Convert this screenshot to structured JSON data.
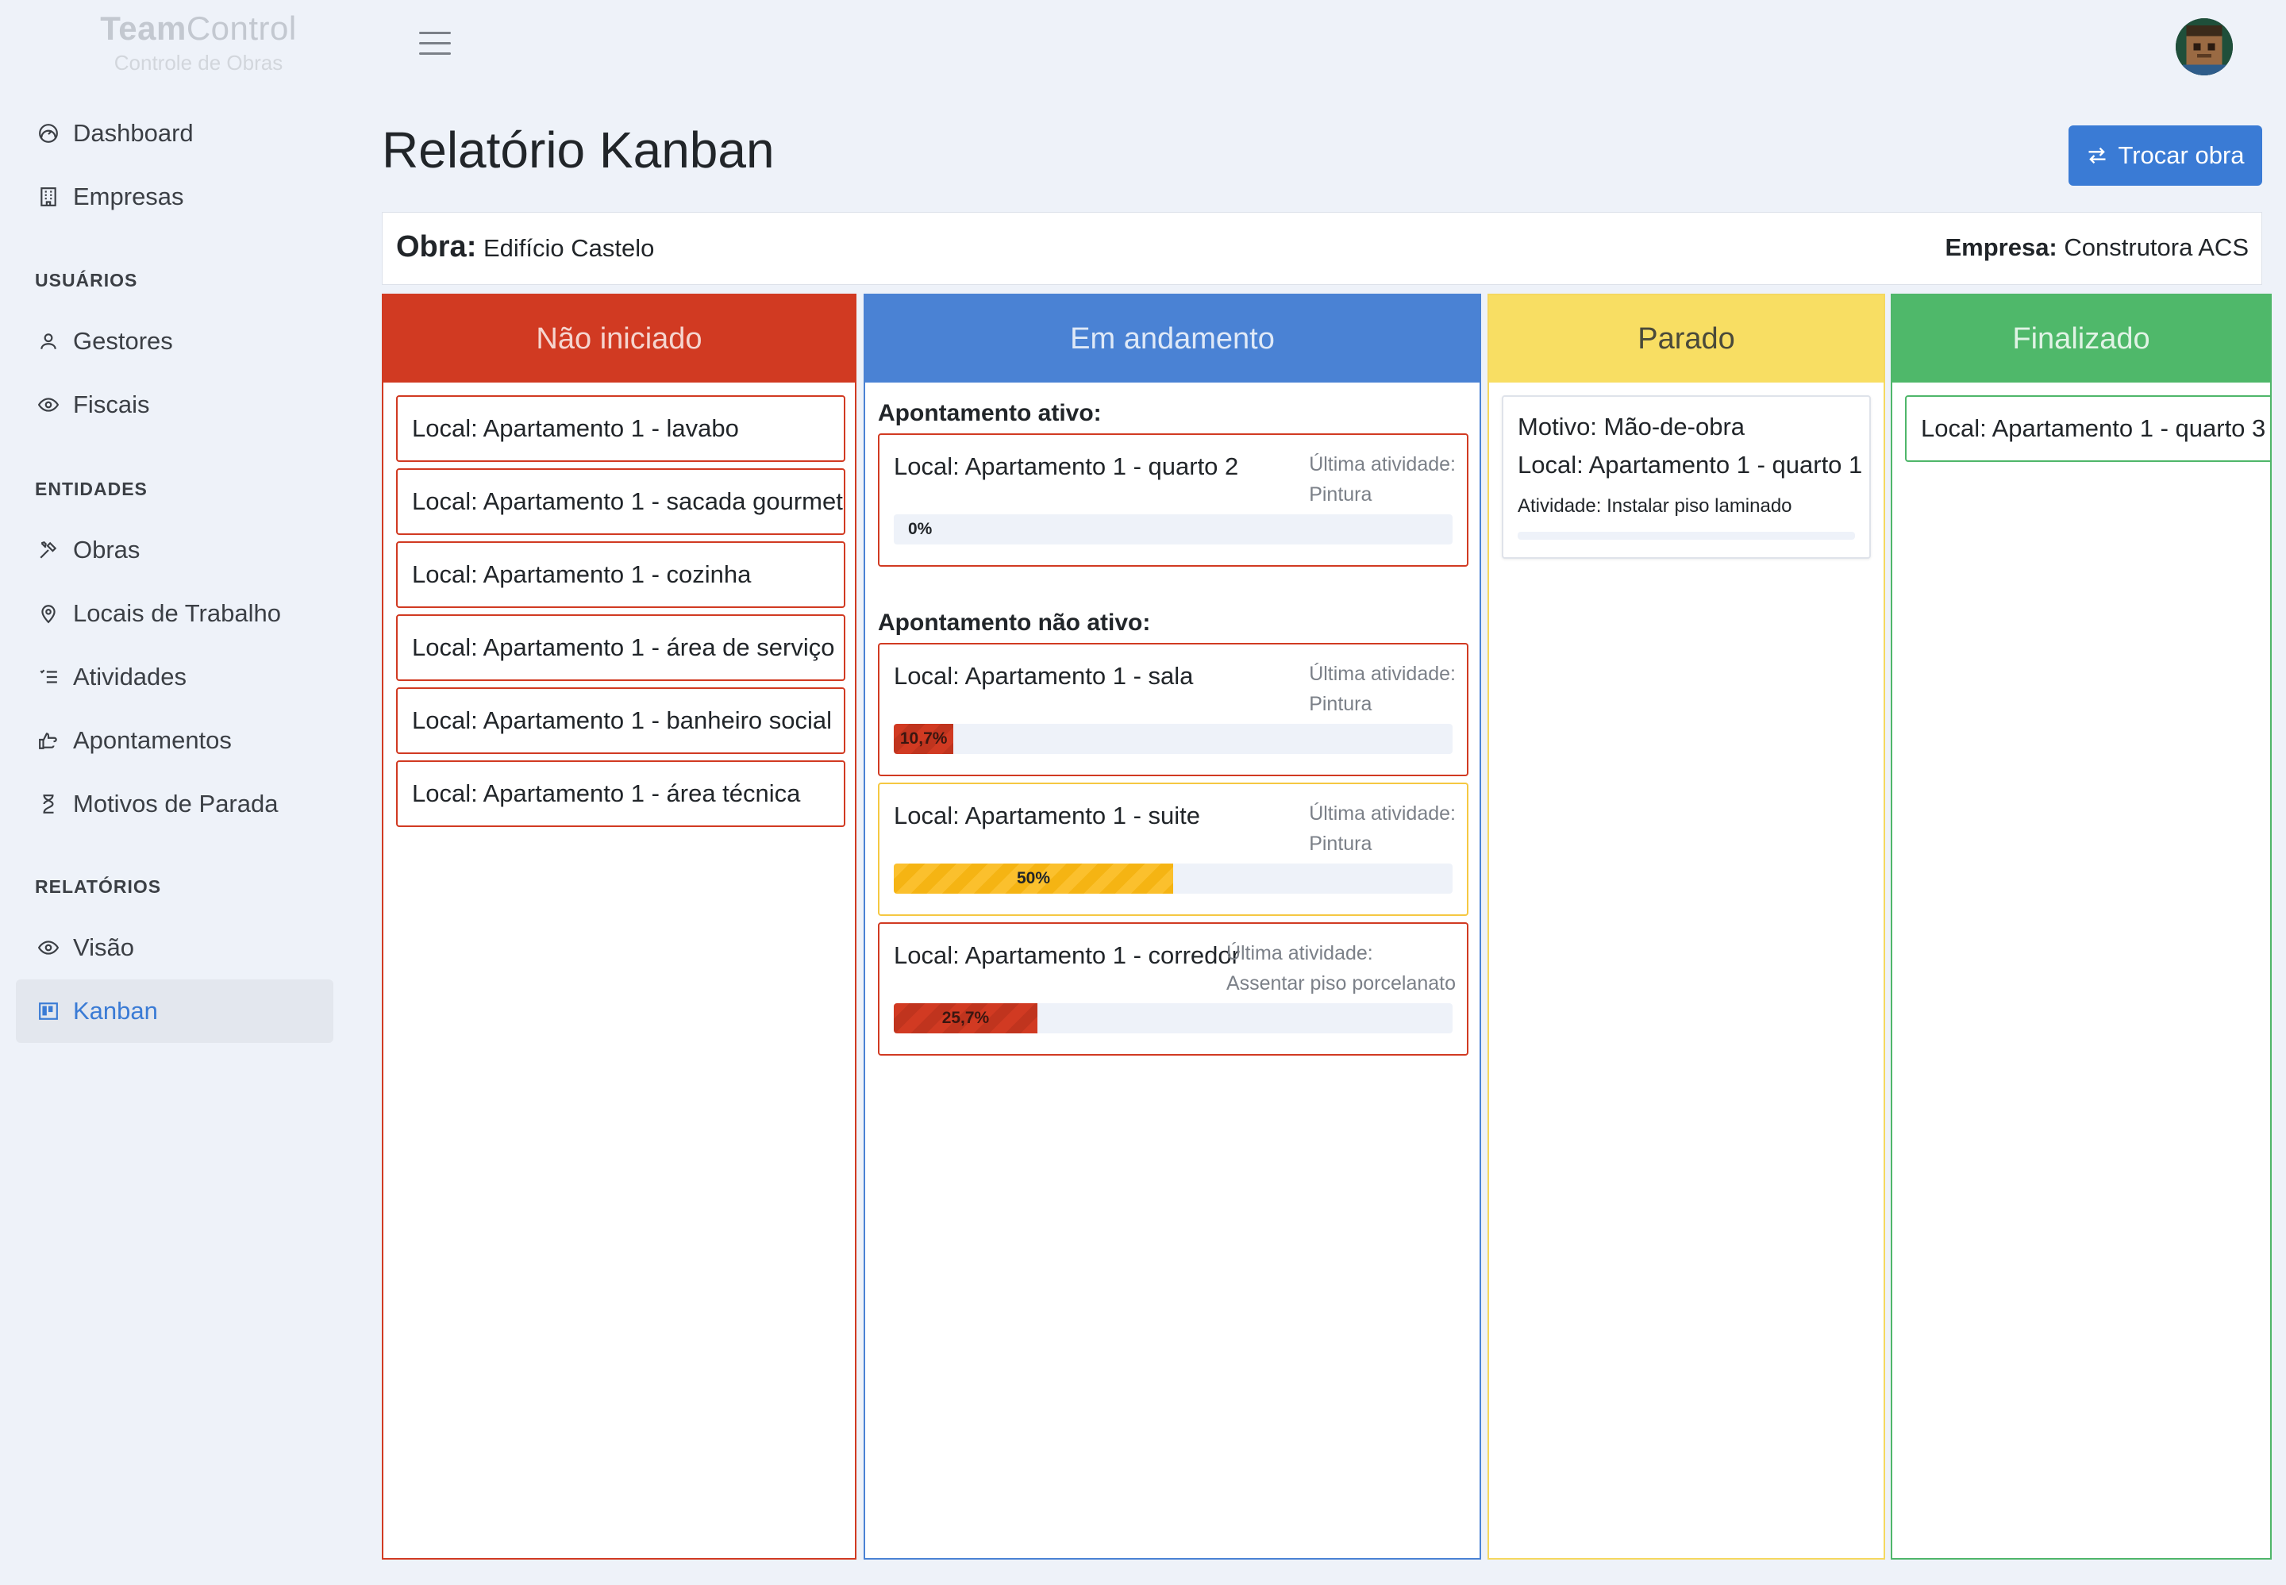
{
  "brand": {
    "title_bold": "Team",
    "title_rest": "Control",
    "subtitle": "Controle de Obras"
  },
  "sidebar": {
    "items": [
      {
        "label": "Dashboard",
        "icon": "speedometer-icon"
      },
      {
        "label": "Empresas",
        "icon": "building-icon"
      }
    ],
    "sections": [
      {
        "title": "USUÁRIOS",
        "items": [
          {
            "label": "Gestores",
            "icon": "person-icon"
          },
          {
            "label": "Fiscais",
            "icon": "eye-icon"
          }
        ]
      },
      {
        "title": "ENTIDADES",
        "items": [
          {
            "label": "Obras",
            "icon": "tools-icon"
          },
          {
            "label": "Locais de Trabalho",
            "icon": "map-pin-icon"
          },
          {
            "label": "Atividades",
            "icon": "list-check-icon"
          },
          {
            "label": "Apontamentos",
            "icon": "hand-pointing-icon"
          },
          {
            "label": "Motivos de Parada",
            "icon": "hourglass-icon"
          }
        ]
      },
      {
        "title": "RELATÓRIOS",
        "items": [
          {
            "label": "Visão",
            "icon": "eye-icon"
          },
          {
            "label": "Kanban",
            "icon": "kanban-icon",
            "active": true
          }
        ]
      }
    ]
  },
  "header": {
    "title": "Relatório Kanban",
    "switch_button": "Trocar obra"
  },
  "info": {
    "obra_label": "Obra:",
    "obra_value": "Edifício Castelo",
    "empresa_label": "Empresa:",
    "empresa_value": "Construtora ACS"
  },
  "columns": {
    "nao_iniciado": {
      "title": "Não iniciado",
      "cards": [
        "Local: Apartamento 1 - lavabo",
        "Local: Apartamento 1 - sacada gourmet",
        "Local: Apartamento 1 - cozinha",
        "Local: Apartamento 1 - área de serviço",
        "Local: Apartamento 1 - banheiro social",
        "Local: Apartamento 1 - área técnica"
      ]
    },
    "em_andamento": {
      "title": "Em andamento",
      "active_label": "Apontamento ativo:",
      "inactive_label": "Apontamento não ativo:",
      "last_activity_label": "Última atividade:",
      "active": [
        {
          "local": "Local: Apartamento 1 - quarto 2",
          "activity": "Pintura",
          "progress": 0,
          "progress_label": "0%",
          "color": "red"
        }
      ],
      "inactive": [
        {
          "local": "Local: Apartamento 1 - sala",
          "activity": "Pintura",
          "progress": 10.7,
          "progress_label": "10,7%",
          "color": "red"
        },
        {
          "local": "Local: Apartamento 1 - suite",
          "activity": "Pintura",
          "progress": 50,
          "progress_label": "50%",
          "color": "yellow"
        },
        {
          "local": "Local: Apartamento 1 - corredor",
          "activity": "Assentar piso porcelanato",
          "progress": 25.7,
          "progress_label": "25,7%",
          "color": "red"
        }
      ]
    },
    "parado": {
      "title": "Parado",
      "cards": [
        {
          "reason": "Motivo: Mão-de-obra",
          "local": "Local: Apartamento 1 - quarto 1",
          "activity": "Atividade: Instalar piso laminado"
        }
      ]
    },
    "finalizado": {
      "title": "Finalizado",
      "cards": [
        "Local: Apartamento 1 - quarto 3"
      ]
    }
  },
  "colors": {
    "red": "#d13a22",
    "blue": "#4a82d4",
    "yellow": "#f8de63",
    "green": "#4fb86a",
    "accent": "#3a7bd5"
  }
}
